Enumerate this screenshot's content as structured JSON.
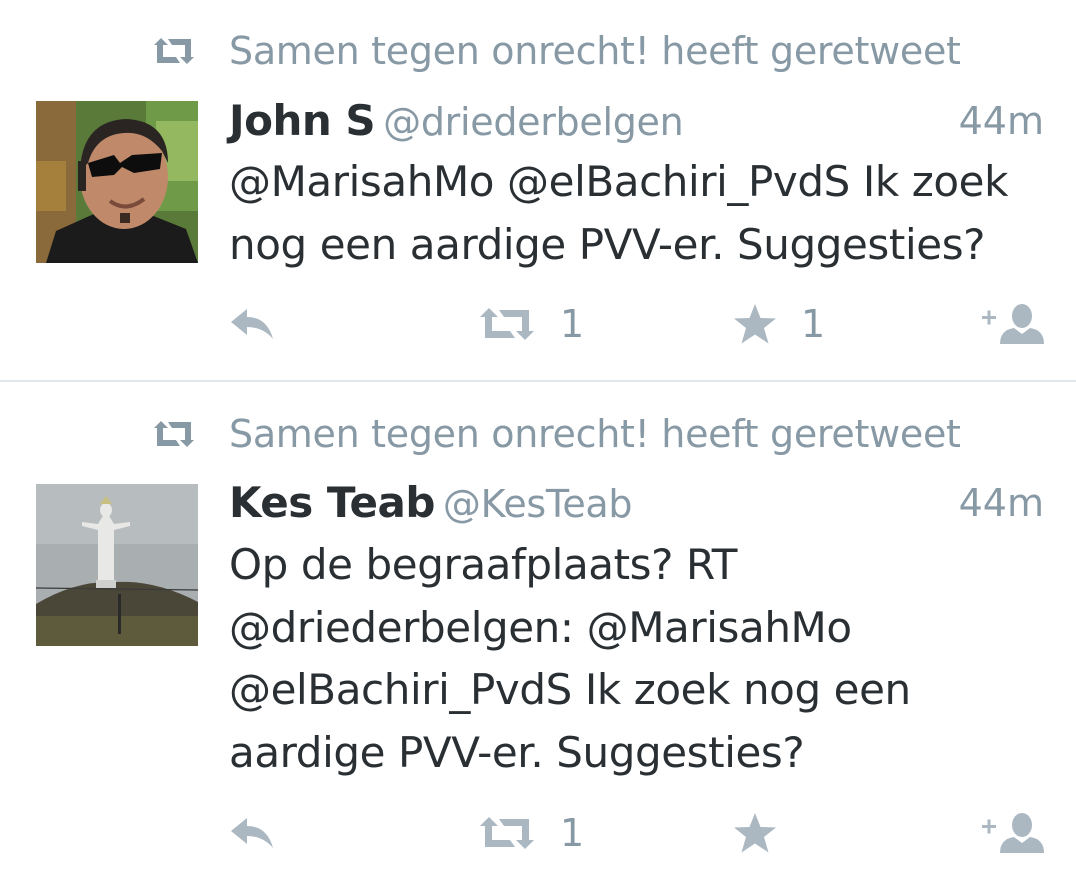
{
  "tweets": [
    {
      "retweeted_by": "Samen tegen onrecht! heeft geretweet",
      "name": "John S",
      "handle": "@driederbelgen",
      "time": "44m",
      "text": "@MarisahMo @elBachiri_PvdS Ik zoek\nnog een aardige PVV-er. Suggesties?",
      "retweet_count": "1",
      "favorite_count": "1",
      "avatar": "photo of man with sunglasses in front of green foliage"
    },
    {
      "retweeted_by": "Samen tegen onrecht! heeft geretweet",
      "name": "Kes Teab",
      "handle": "@KesTeab",
      "time": "44m",
      "text": "Op de begraafplaats? RT\n@driederbelgen: @MarisahMo\n@elBachiri_PvdS Ik zoek nog een\naardige PVV-er. Suggesties?",
      "retweet_count": "1",
      "favorite_count": "",
      "avatar": "photo of white statue with outstretched arms on a hill under grey sky"
    }
  ],
  "colors": {
    "text": "#292f33",
    "muted": "#8899a6",
    "icon": "#abb8c2",
    "divider": "#e1e8ed"
  }
}
